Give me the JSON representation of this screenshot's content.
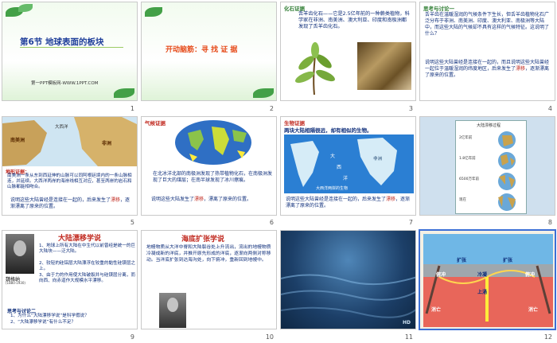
{
  "slides": [
    {
      "num": "1",
      "title": "第6节  地球表面的板块",
      "footer": "第一PPT模板网-WWW.1PPT.COM"
    },
    {
      "num": "2",
      "title": "开动脑筋：寻 找 证 据"
    },
    {
      "num": "3",
      "tag": "化石证据",
      "text": "舌羊齿化石——它是2.5亿年前的一种蕨类植物，科学家在非洲、南美洲、澳大利亚、印度和南极洲都发现了舌羊齿化石。"
    },
    {
      "num": "4",
      "tag": "思考与讨论一",
      "text1": "舌羊齿在温暖湿润的气候条件下生长，但舌羊齿植物化石广泛分布于非洲、南美洲、印度、澳大利亚、南极洲等大陆中，而这些大陆的气候却不具有这样的气候特征。这说明了什么？",
      "text2": "说明这些大陆曾经是连接在一起的，而且说明这些大陆曾经一起位于温暖湿润的纬度地区，后来发生了",
      "text2_red": "漂移",
      "text2_end": "，逐渐漂离了原来的位置。"
    },
    {
      "num": "5",
      "map_labels": [
        "大西洋",
        "南美洲",
        "非洲"
      ],
      "tag": "地形证据：",
      "text1": "南美洲一条从东到西延伸的山脉可以同阿根廷境内的一条山脉相连，并延续。大西洋两岸的海岸线相互对应，甚至两岸的岩石和山脉都能相吻合。",
      "text2": "说明这些大陆曾经是连接在一起的，后来发生了",
      "text2_red": "漂移",
      "text2_end": "，逐渐漂离了原来的位置。"
    },
    {
      "num": "6",
      "tag": "气候证据",
      "text1": "在北冰洋北部的南极洲发现了热带植物化石，在南极洲发现了巨大的煤层；在南半球发现了冰川擦痕。",
      "text2": "说明这些大陆发生了",
      "text2_red": "漂移",
      "text2_end": "，漂离了原来的位置。"
    },
    {
      "num": "7",
      "tag": "生物证据",
      "heading": "两块大陆相隔很远，却有相似的生物。",
      "map_labels": [
        "大",
        "西",
        "洋",
        "非洲"
      ],
      "caption": "大西洋两岸的生物",
      "text2": "说明这些大陆曾经是连接在一起的，后来发生了",
      "text2_red": "漂移",
      "text2_end": "，逐渐漂离了原来的位置。"
    },
    {
      "num": "8",
      "chart_title": "大陆漂移过程",
      "stages": [
        "2亿年前",
        "1.8亿年前",
        "6500万年前",
        "现在"
      ]
    },
    {
      "num": "9",
      "title": "大陆漂移学说",
      "items": [
        "1、地球上所有大陆在中生代以前曾经是统一的巨大陆块——泛大陆。",
        "2、较轻的硅铝层大陆漂浮在较重的黏性硅镁层之上。",
        "3、由于力的作用使大陆破裂并与硅镁层分离，而向西、向赤道作大规模水平漂移。"
      ],
      "person": "魏格纳",
      "person_years": "(1880-1930)",
      "q_tag": "思考与讨论二",
      "questions": [
        "1、为什么“大陆漂移学说”是科学假说？",
        "2、“大陆漂移学说”有什么不足？"
      ]
    },
    {
      "num": "10",
      "title": "海底扩张学说",
      "text": "地幔物质从大洋中脊和大陆裂谷处上升流出，流出的地幔物质冷凝成新的洋底，并推开原先形成的洋底，逐渐向两侧对称移动。当洋底扩张到达海沟处，向下俯冲，重新回到地幔中。"
    },
    {
      "num": "11",
      "badge": "HD"
    },
    {
      "num": "12",
      "labels": [
        "扩张",
        "扩张",
        "冷凝",
        "上涌",
        "俯冲",
        "俯冲",
        "消亡",
        "消亡"
      ]
    }
  ],
  "colors": {
    "green": "#2e7d32",
    "blue": "#1a73c9",
    "red": "#c0281e",
    "navy": "#0d2d7a",
    "selection": "#3c6fd6"
  }
}
